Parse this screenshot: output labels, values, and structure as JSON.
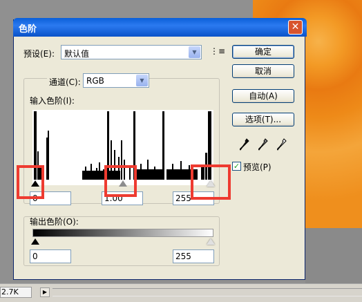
{
  "dialog": {
    "title": "色阶",
    "preset_label": "预设(E):",
    "preset_value": "默认值",
    "channel_label": "通道(C):",
    "channel_value": "RGB",
    "input_levels_label": "输入色阶(I):",
    "input_black": "0",
    "input_gamma": "1.00",
    "input_white": "255",
    "output_levels_label": "输出色阶(O):",
    "output_black": "0",
    "output_white": "255"
  },
  "buttons": {
    "ok": "确定",
    "cancel": "取消",
    "auto": "自动(A)",
    "options": "选项(T)..."
  },
  "preview": {
    "label": "预览(P)",
    "checked": true
  },
  "statusbar": {
    "zoom": "2.7K"
  },
  "icons": [
    "close-icon",
    "menu-icon",
    "chevron-down-icon",
    "black-eyedropper-icon",
    "gray-eyedropper-icon",
    "white-eyedropper-icon",
    "checkmark-icon"
  ],
  "colors": {
    "titlebar": "#0a5fd8",
    "highlight": "#ee3b30",
    "dialog_bg": "#ece9d8"
  }
}
